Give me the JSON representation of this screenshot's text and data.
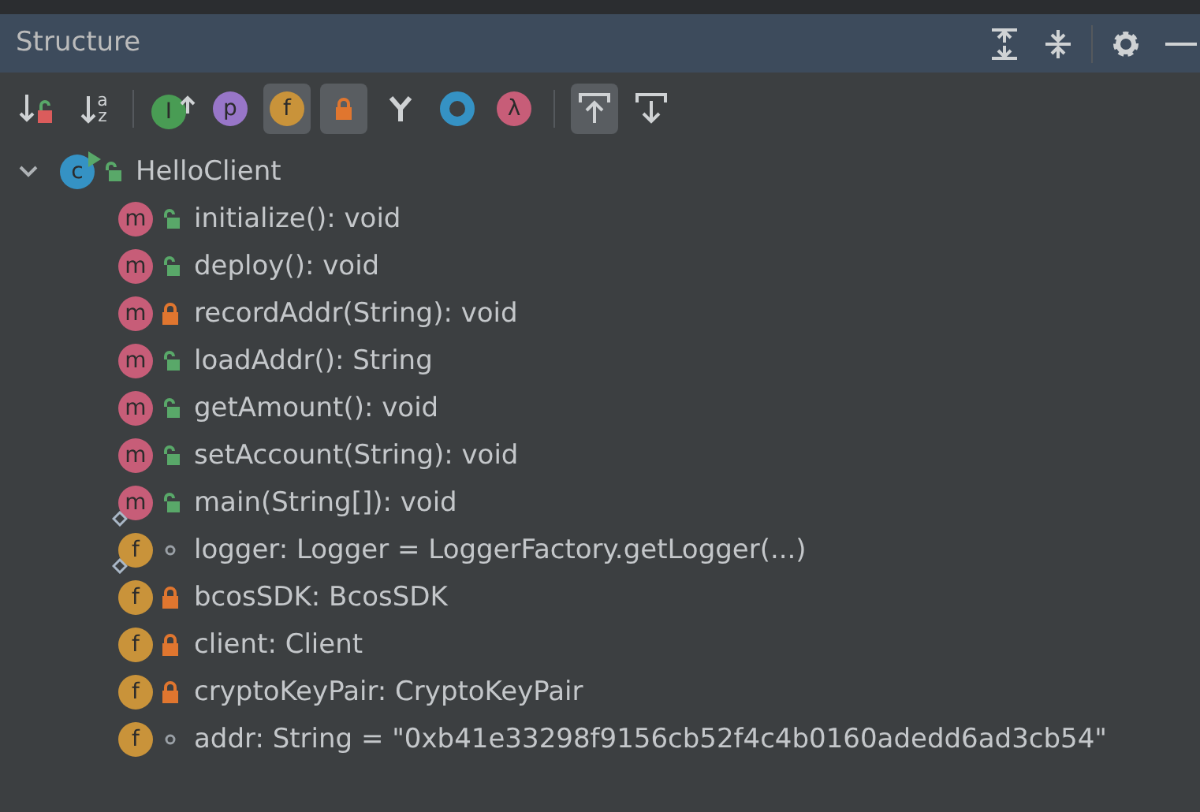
{
  "panel": {
    "title": "Structure"
  },
  "header_actions": [
    {
      "kind": "expand-all"
    },
    {
      "kind": "collapse-all"
    },
    {
      "kind": "settings"
    },
    {
      "kind": "hide"
    }
  ],
  "toolbar": [
    {
      "kind": "sort-visibility",
      "selected": false
    },
    {
      "kind": "sort-alpha",
      "selected": false,
      "glyph": "a",
      "glyph2": "z"
    },
    {
      "kind": "separator"
    },
    {
      "kind": "inherited",
      "selected": false,
      "glyph": "I"
    },
    {
      "kind": "badge",
      "selected": false,
      "glyph": "p",
      "color": "#9876c8"
    },
    {
      "kind": "badge",
      "selected": true,
      "glyph": "f",
      "color": "#c9933a"
    },
    {
      "kind": "lock",
      "selected": true
    },
    {
      "kind": "fork",
      "selected": false
    },
    {
      "kind": "ring",
      "selected": false,
      "color": "#3592c4"
    },
    {
      "kind": "badge",
      "selected": false,
      "glyph": "λ",
      "color": "#c75d78"
    },
    {
      "kind": "separator"
    },
    {
      "kind": "scroll-from",
      "selected": true
    },
    {
      "kind": "scroll-to",
      "selected": false
    }
  ],
  "tree": [
    {
      "label": "HelloClient",
      "glyph": "c",
      "kind": "public",
      "expanded": true,
      "children": [
        {
          "label": "initialize(): void",
          "glyph": "m",
          "kind": "public",
          "static": false
        },
        {
          "label": "deploy(): void",
          "glyph": "m",
          "kind": "public",
          "static": false
        },
        {
          "label": "recordAddr(String): void",
          "glyph": "m",
          "kind": "private",
          "static": false
        },
        {
          "label": "loadAddr(): String",
          "glyph": "m",
          "kind": "public",
          "static": false
        },
        {
          "label": "getAmount(): void",
          "glyph": "m",
          "kind": "public",
          "static": false
        },
        {
          "label": "setAccount(String): void",
          "glyph": "m",
          "kind": "public",
          "static": false
        },
        {
          "label": "main(String[]): void",
          "glyph": "m",
          "kind": "public",
          "static": true
        },
        {
          "label": "logger: Logger = LoggerFactory.getLogger(...)",
          "glyph": "f",
          "kind": "package",
          "static": true
        },
        {
          "label": "bcosSDK: BcosSDK",
          "glyph": "f",
          "kind": "private",
          "static": false
        },
        {
          "label": "client: Client",
          "glyph": "f",
          "kind": "private",
          "static": false
        },
        {
          "label": "cryptoKeyPair: CryptoKeyPair",
          "glyph": "f",
          "kind": "private",
          "static": false
        },
        {
          "label": "addr: String = \"0xb41e33298f9156cb52f4c4b0160adedd6ad3cb54\"",
          "glyph": "f",
          "kind": "package",
          "static": false
        }
      ]
    }
  ]
}
